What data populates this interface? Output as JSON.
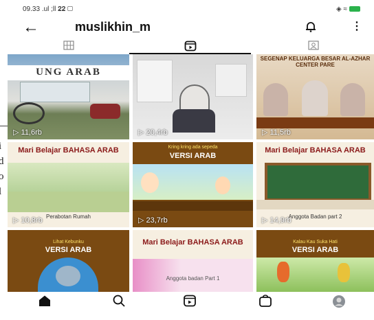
{
  "status": {
    "time": "09.33",
    "signal_text": ".ul  ;ll 𝟐𝟐 ▢",
    "right_text": "◈ ≈"
  },
  "header": {
    "username": "muslikhin_m"
  },
  "edge_text": [
    "i",
    "d",
    "o",
    "l"
  ],
  "tabs": [
    {
      "icon": "grid-icon",
      "active": false
    },
    {
      "icon": "reels-icon",
      "active": true
    },
    {
      "icon": "tagged-icon",
      "active": false
    }
  ],
  "posts": [
    {
      "views": "▷ 11,6rb",
      "overlay": "UNG   ARAB",
      "caption": ""
    },
    {
      "views": "▷ 20,4rb",
      "overlay": "",
      "caption": ""
    },
    {
      "views": "▷ 11,5rb",
      "overlay": "SEGENAP KELUARGA BESAR AL-AZHAR CENTER PARE",
      "caption": ""
    },
    {
      "views": "▷ 10,8rb",
      "overlay": "Mari Belajar BAHASA ARAB",
      "caption": "Perabotan Rumah"
    },
    {
      "views": "▷ 23,7rb",
      "overlay": "VERSI ARAB",
      "caption": "Kring kring ada sepeda"
    },
    {
      "views": "▷ 14,9rb",
      "overlay": "Mari Belajar BAHASA ARAB",
      "caption": "Anggota Badan part 2"
    },
    {
      "views": "",
      "overlay": "VERSI ARAB",
      "caption": "Lihat Kebunku"
    },
    {
      "views": "",
      "overlay": "Mari Belajar BAHASA ARAB",
      "caption": "Anggota badan Part 1"
    },
    {
      "views": "",
      "overlay": "VERSI ARAB",
      "caption": "Kalau Kau Suka Hati"
    }
  ],
  "nav": [
    "home-icon",
    "search-icon",
    "reels-icon",
    "shop-icon",
    "profile-avatar"
  ],
  "colors": {
    "banner_red": "#8b1a1a",
    "accent_green": "#2bb24c"
  }
}
